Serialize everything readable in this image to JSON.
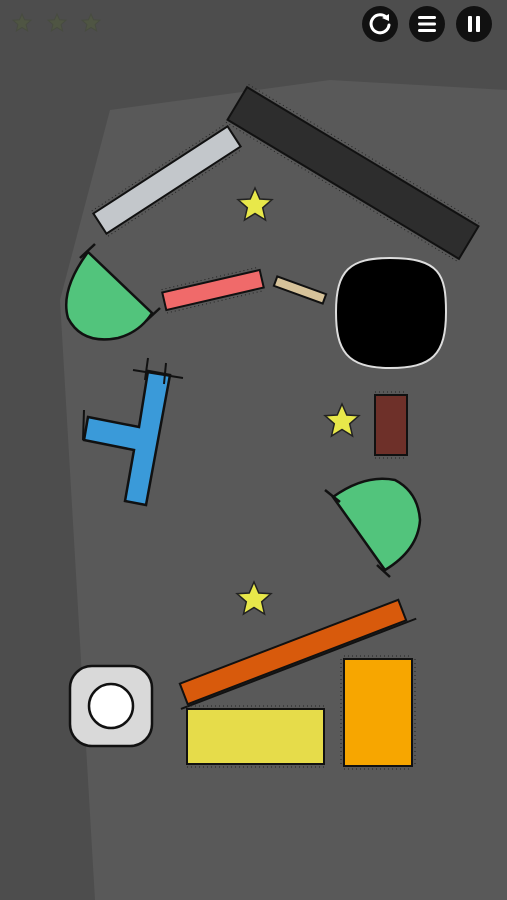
{
  "hud": {
    "stars_collected": 0,
    "stars_total": 3,
    "buttons": [
      {
        "name": "restart",
        "icon": "restart-icon"
      },
      {
        "name": "menu",
        "icon": "menu-icon"
      },
      {
        "name": "pause",
        "icon": "pause-icon"
      }
    ]
  },
  "level": {
    "stars_on_board": 3,
    "objects": [
      {
        "kind": "plank",
        "color": "#c3c7cb"
      },
      {
        "kind": "plank",
        "color": "#2d2d2d"
      },
      {
        "kind": "quarter-disc",
        "color": "#52c47c"
      },
      {
        "kind": "plank",
        "color": "#f06a6a"
      },
      {
        "kind": "plank",
        "color": "#d7c39a"
      },
      {
        "kind": "black-blob",
        "color": "#000000"
      },
      {
        "kind": "t-shape",
        "color": "#3a9ad9"
      },
      {
        "kind": "block",
        "color": "#6e3029"
      },
      {
        "kind": "quarter-disc",
        "color": "#52c47c"
      },
      {
        "kind": "plank",
        "color": "#d85a0c"
      },
      {
        "kind": "block",
        "color": "#e6dc4a"
      },
      {
        "kind": "block",
        "color": "#f7a600"
      },
      {
        "kind": "ball-launcher",
        "color": "#d9d9d9"
      }
    ]
  },
  "colors": {
    "background": "#595959",
    "star": "#e8e84a",
    "hud_star_empty": "#4f5543"
  }
}
